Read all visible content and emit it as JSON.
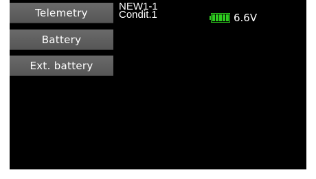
{
  "menu": {
    "telemetry_label": "Telemetry",
    "battery_label": "Battery",
    "ext_battery_label": "Ext. battery"
  },
  "status": {
    "model_name": "NEW1-1",
    "condition": "Condit.1",
    "battery_voltage": "6.6V",
    "battery_level": 1.0,
    "battery_icon": "battery-icon",
    "battery_color": "#2ecc1f"
  },
  "colors": {
    "screen_background": "#000000",
    "button_background": "#606060",
    "text": "#ffffff"
  }
}
